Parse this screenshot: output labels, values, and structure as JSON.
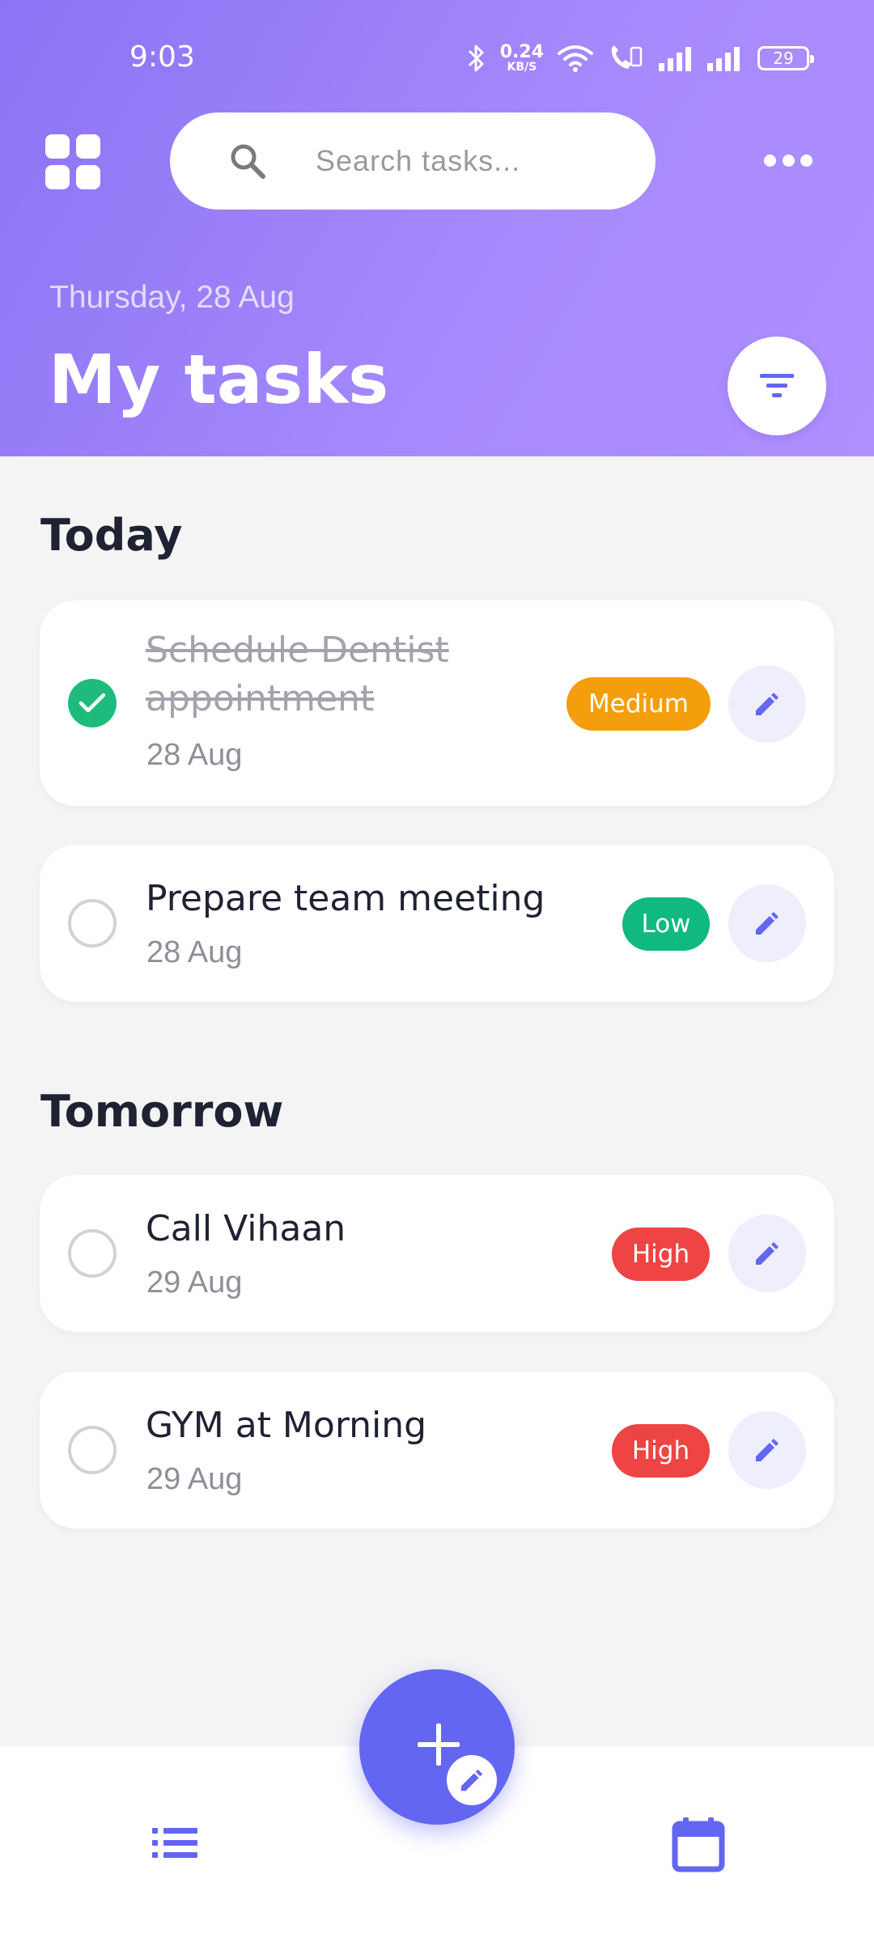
{
  "status_bar": {
    "time": "9:03",
    "net_speed_value": "0.24",
    "net_speed_unit": "KB/S",
    "battery": "29"
  },
  "header": {
    "search_placeholder": "Search tasks...",
    "date": "Thursday, 28 Aug",
    "title": "My tasks"
  },
  "sections": [
    {
      "title": "Today",
      "tasks": [
        {
          "title": "Schedule Dentist appointment",
          "date": "28 Aug",
          "priority": "Medium",
          "completed": true
        },
        {
          "title": "Prepare team meeting",
          "date": "28 Aug",
          "priority": "Low",
          "completed": false
        }
      ]
    },
    {
      "title": "Tomorrow",
      "tasks": [
        {
          "title": "Call Vihaan",
          "date": "29 Aug",
          "priority": "High",
          "completed": false
        },
        {
          "title": "GYM at Morning",
          "date": "29 Aug",
          "priority": "High",
          "completed": false
        }
      ]
    }
  ],
  "icons": {
    "menu": "grid-icon",
    "search": "search-icon",
    "more": "more-horizontal-icon",
    "filter": "filter-icon",
    "complete": "check-icon",
    "edit": "pencil-icon",
    "add": "plus-icon",
    "nav_list": "list-icon",
    "nav_calendar": "calendar-icon"
  },
  "colors": {
    "accent": "#6366f1",
    "header_gradient_start": "#8b73f3",
    "header_gradient_end": "#b08ffe",
    "priority_medium": "#f59e0b",
    "priority_low": "#10b981",
    "priority_high": "#ef4444",
    "completed_check": "#1ebc7c"
  }
}
